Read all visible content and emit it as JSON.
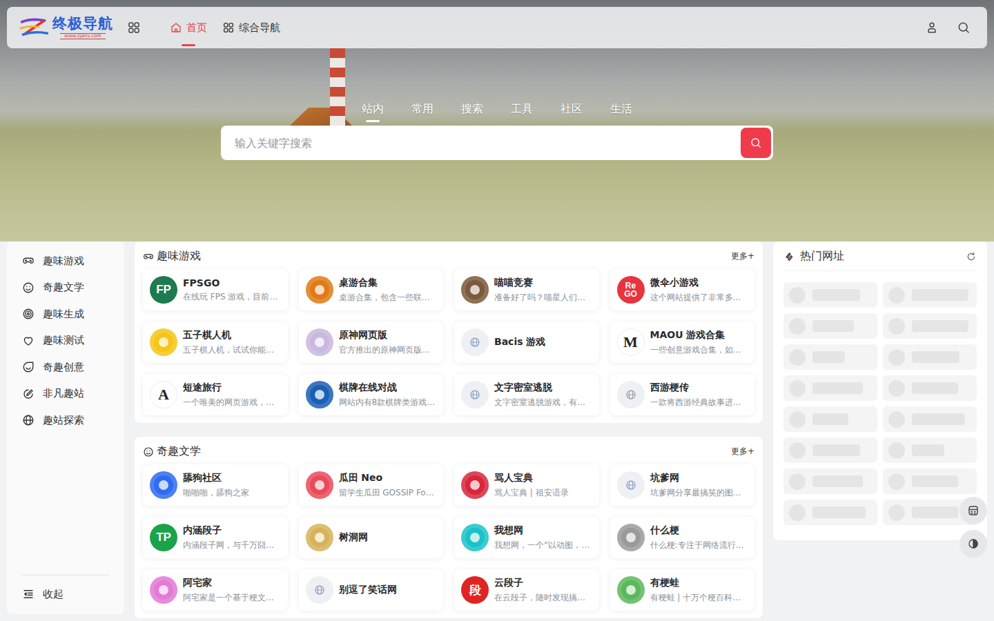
{
  "logo": {
    "title": "终极导航",
    "url": "www.zjanv.com"
  },
  "nav": [
    {
      "label": "首页",
      "selected": true
    },
    {
      "label": "综合导航",
      "selected": false
    }
  ],
  "search": {
    "tabs": [
      {
        "label": "站内",
        "selected": true
      },
      {
        "label": "常用",
        "selected": false
      },
      {
        "label": "搜索",
        "selected": false
      },
      {
        "label": "工具",
        "selected": false
      },
      {
        "label": "社区",
        "selected": false
      },
      {
        "label": "生活",
        "selected": false
      }
    ],
    "placeholder": "输入关键字搜索"
  },
  "sidebar": {
    "items": [
      {
        "label": "趣味游戏"
      },
      {
        "label": "奇趣文学"
      },
      {
        "label": "趣味生成"
      },
      {
        "label": "趣味测试"
      },
      {
        "label": "奇趣创意"
      },
      {
        "label": "非凡趣站"
      },
      {
        "label": "趣站探索"
      }
    ],
    "collapse": "收起"
  },
  "sections": [
    {
      "title": "趣味游戏",
      "more": "更多+",
      "sites": [
        {
          "name": "FPSGO",
          "desc": "在线玩 FPS 游戏，目前…",
          "icon": {
            "kind": "letter",
            "text": "FP",
            "color": "#1e7a4f"
          }
        },
        {
          "name": "桌游合集",
          "desc": "桌游合集，包含一些联…",
          "icon": {
            "kind": "emblem",
            "text": "",
            "color": "#e07b17"
          }
        },
        {
          "name": "喵喵竞赛",
          "desc": "准备好了吗？喵星人们…",
          "icon": {
            "kind": "emblem",
            "text": "",
            "color": "#7a5a3a"
          }
        },
        {
          "name": "微伞小游戏",
          "desc": "这个网站提供了非常多…",
          "icon": {
            "kind": "letter",
            "text": "Re GO",
            "color": "#e8343f"
          }
        },
        {
          "name": "五子棋人机",
          "desc": "五子棋人机，试试你能…",
          "icon": {
            "kind": "emblem",
            "text": "",
            "color": "#f5c518"
          }
        },
        {
          "name": "原神网页版",
          "desc": "官方推出的原神网页版…",
          "icon": {
            "kind": "emblem",
            "text": "",
            "color": "#c9b8e0"
          }
        },
        {
          "name": "Bacis 游戏",
          "desc": "",
          "icon": {
            "kind": "globe",
            "text": "",
            "color": "#8ea0c4"
          }
        },
        {
          "name": "MAOU 游戏合集",
          "desc": "一些创意游戏合集，如…",
          "icon": {
            "kind": "mark",
            "text": "M",
            "color": "#222222"
          }
        },
        {
          "name": "短途旅行",
          "desc": "一个唯美的网页游戏，…",
          "icon": {
            "kind": "mark",
            "text": "A",
            "color": "#222222"
          }
        },
        {
          "name": "棋牌在线对战",
          "desc": "网站内有8款棋牌类游戏…",
          "icon": {
            "kind": "emblem",
            "text": "",
            "color": "#1a5fb4"
          }
        },
        {
          "name": "文字密室逃脱",
          "desc": "文字密室逃脱游戏，有…",
          "icon": {
            "kind": "globe",
            "text": "",
            "color": "#8ea0c4"
          }
        },
        {
          "name": "西游梗传",
          "desc": "一款将西游经典故事进…",
          "icon": {
            "kind": "globe",
            "text": "",
            "color": "#9aa0a8"
          }
        }
      ]
    },
    {
      "title": "奇趣文学",
      "more": "更多+",
      "sites": [
        {
          "name": "舔狗社区",
          "desc": "啪啪啪，舔狗之家",
          "icon": {
            "kind": "emblem",
            "text": "",
            "color": "#2f6bf0"
          }
        },
        {
          "name": "瓜田 Neo",
          "desc": "留学生瓜田 GOSSIP Fo…",
          "icon": {
            "kind": "emblem",
            "text": "",
            "color": "#e94b5b"
          }
        },
        {
          "name": "骂人宝典",
          "desc": "骂人宝典 | 祖安语录",
          "icon": {
            "kind": "emblem",
            "text": "",
            "color": "#d7263d"
          }
        },
        {
          "name": "坑爹网",
          "desc": "坑爹网分享最搞笑的图…",
          "icon": {
            "kind": "globe",
            "text": "",
            "color": "#8ea0c4"
          }
        },
        {
          "name": "内涵段子",
          "desc": "内涵段子网，与千万囧…",
          "icon": {
            "kind": "letter",
            "text": "TP",
            "color": "#1aa34a"
          }
        },
        {
          "name": "树洞网",
          "desc": "",
          "icon": {
            "kind": "emblem",
            "text": "",
            "color": "#d8b25a"
          }
        },
        {
          "name": "我想网",
          "desc": "我想网，一个“以动图，…",
          "icon": {
            "kind": "emblem",
            "text": "",
            "color": "#19c2c9"
          }
        },
        {
          "name": "什么梗",
          "desc": "什么梗:专注于网络流行…",
          "icon": {
            "kind": "emblem",
            "text": "",
            "color": "#9a9a9a"
          }
        },
        {
          "name": "阿宅家",
          "desc": "阿宅家是一个基于梗文…",
          "icon": {
            "kind": "emblem",
            "text": "",
            "color": "#e27ad6"
          }
        },
        {
          "name": "别逗了笑话网",
          "desc": "",
          "icon": {
            "kind": "globe",
            "text": "",
            "color": "#8ea0c4"
          }
        },
        {
          "name": "云段子",
          "desc": "在云段子，随时发现搞…",
          "icon": {
            "kind": "letter",
            "text": "段",
            "color": "#e02424"
          }
        },
        {
          "name": "有梗蛙",
          "desc": "有梗蛙 | 十万个梗百科…",
          "icon": {
            "kind": "emblem",
            "text": "",
            "color": "#5cb85c"
          }
        }
      ]
    }
  ],
  "hot": {
    "title": "热门网址",
    "placeholders": [
      {
        "level": 0.8
      },
      {
        "level": 0.95
      },
      {
        "level": 0.7
      },
      {
        "level": 0.95
      },
      {
        "level": 0.55
      },
      {
        "level": 0.8
      },
      {
        "level": 0.85
      },
      {
        "level": 0.78
      },
      {
        "level": 0.6
      },
      {
        "level": 0.9
      },
      {
        "level": 0.8
      },
      {
        "level": 0.55
      },
      {
        "level": 0.85
      },
      {
        "level": 0.78
      },
      {
        "level": 0.9
      },
      {
        "level": 0.78
      }
    ]
  }
}
